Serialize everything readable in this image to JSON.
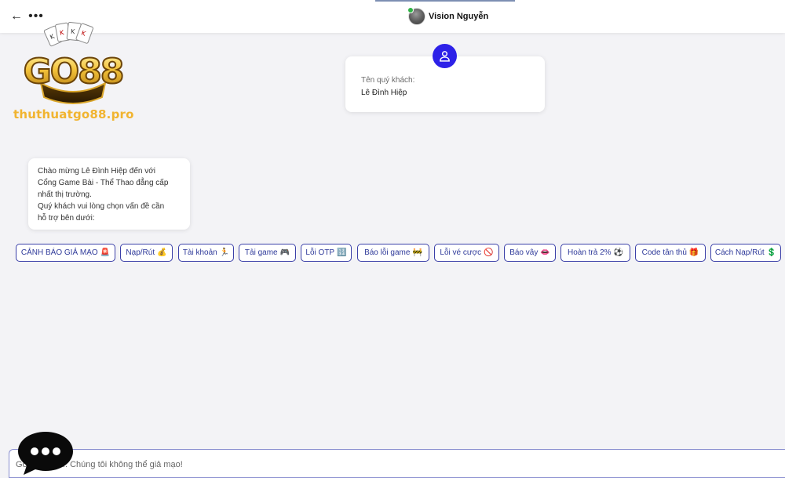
{
  "header": {
    "back_icon": "arrow-left-icon",
    "more_icon": "ellipsis-icon",
    "back_glyph": "←",
    "more_glyph": "•••",
    "agent_name": "Vision Nguyễn",
    "agent_status_color": "#2fb344"
  },
  "logo": {
    "text": "GO88",
    "cards": "KKKK",
    "watermark": "thuthuatgo88.pro"
  },
  "customer": {
    "label": "Tên quý khách:",
    "value": "Lê Đình Hiệp",
    "icon": "user-icon",
    "icon_color": "#2d21e8"
  },
  "bot_message": {
    "lines": [
      "Chào mừng Lê Đình Hiệp đến với",
      "Cổng Game Bài - Thể Thao đẳng cấp",
      "nhất thị trường.",
      "Quý khách vui lòng chọn vấn đề cần",
      "hỗ trợ bên dưới:"
    ]
  },
  "quick_replies": [
    {
      "label": "CẢNH BÁO GIẢ MẠO",
      "emoji": "🚨"
    },
    {
      "label": "Nạp/Rút",
      "emoji": "💰"
    },
    {
      "label": "Tài khoản",
      "emoji": "🏃"
    },
    {
      "label": "Tải game",
      "emoji": "🎮"
    },
    {
      "label": "Lỗi OTP",
      "emoji": "🔢"
    },
    {
      "label": "Báo lỗi game",
      "emoji": "🚧"
    },
    {
      "label": "Lỗi vé cược",
      "emoji": "🚫"
    },
    {
      "label": "Báo vây",
      "emoji": "👄"
    },
    {
      "label": "Hoàn trả 2%",
      "emoji": "⚽"
    },
    {
      "label": "Code tân thủ",
      "emoji": "🎁"
    },
    {
      "label": "Cách Nạp/Rút",
      "emoji": "💲"
    }
  ],
  "composer": {
    "placeholder": "Gõ tin nhắn... Chúng tôi không thể giả mạo!",
    "visible_fragment": "không thể giả mạo!"
  },
  "chat_bubble_icon": "chat-bubble-icon"
}
